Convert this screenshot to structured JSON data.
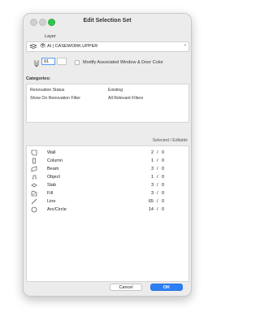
{
  "window": {
    "title": "Edit Selection Set"
  },
  "layer": {
    "label": "Layer",
    "value": "AI | CASEWORK.UPPER"
  },
  "pen": {
    "value": "91",
    "modify_label": "Modify Associated Window & Door Color",
    "modify_checked": false
  },
  "categories": {
    "label": "Categories:",
    "rows": [
      {
        "name": "Renovation Status",
        "value": "Existing"
      },
      {
        "name": "Show On Renovation Filter",
        "value": "All Relevant Filters"
      }
    ]
  },
  "list": {
    "header": "Selected / Editable",
    "items": [
      {
        "name": "Wall",
        "selected": "2",
        "editable": "0",
        "icon": "wall-icon"
      },
      {
        "name": "Column",
        "selected": "1",
        "editable": "0",
        "icon": "column-icon"
      },
      {
        "name": "Beam",
        "selected": "3",
        "editable": "0",
        "icon": "beam-icon"
      },
      {
        "name": "Object",
        "selected": "1",
        "editable": "0",
        "icon": "object-icon"
      },
      {
        "name": "Slab",
        "selected": "3",
        "editable": "0",
        "icon": "slab-icon"
      },
      {
        "name": "Fill",
        "selected": "3",
        "editable": "0",
        "icon": "fill-icon"
      },
      {
        "name": "Line",
        "selected": "65",
        "editable": "0",
        "icon": "line-icon"
      },
      {
        "name": "Arc/Circle",
        "selected": "14",
        "editable": "0",
        "icon": "arc-circle-icon"
      }
    ]
  },
  "buttons": {
    "cancel": "Cancel",
    "ok": "OK"
  },
  "colors": {
    "accent": "#2d7ff5",
    "maximize": "#2ec94a"
  }
}
